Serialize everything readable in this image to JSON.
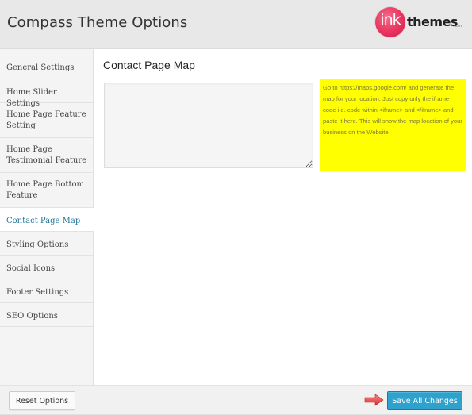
{
  "header": {
    "title": "Compass Theme Options",
    "logo": {
      "mark": "ink",
      "word": "themes",
      "suffix": ".com",
      "brand_color": "#e8345e"
    }
  },
  "sidebar": {
    "items": [
      {
        "label": "General Settings",
        "active": false
      },
      {
        "label": "Home Slider Settings",
        "active": false
      },
      {
        "label": "Home Page Feature Setting",
        "active": false
      },
      {
        "label": "Home Page Testimonial Feature",
        "active": false
      },
      {
        "label": "Home Page Bottom Feature",
        "active": false
      },
      {
        "label": "Contact Page Map",
        "active": true
      },
      {
        "label": "Styling Options",
        "active": false
      },
      {
        "label": "Social Icons",
        "active": false
      },
      {
        "label": "Footer Settings",
        "active": false
      },
      {
        "label": "SEO Options",
        "active": false
      }
    ],
    "active_color": "#21759b"
  },
  "main": {
    "section_title": "Contact Page Map",
    "map_code": {
      "value": "",
      "placeholder": ""
    },
    "hint": "Go to https://maps.google.com/ and generate the map for your location. Just copy only the iframe code i.e. code within <iframe> and </iframe> and paste it here. This will show the map location of your business on the Website.",
    "hint_bg": "#ffff00"
  },
  "footer": {
    "reset_label": "Reset Options",
    "save_label": "Save All Changes",
    "arrow_icon": "right-arrow-icon",
    "save_color": "#2ea2cc"
  }
}
